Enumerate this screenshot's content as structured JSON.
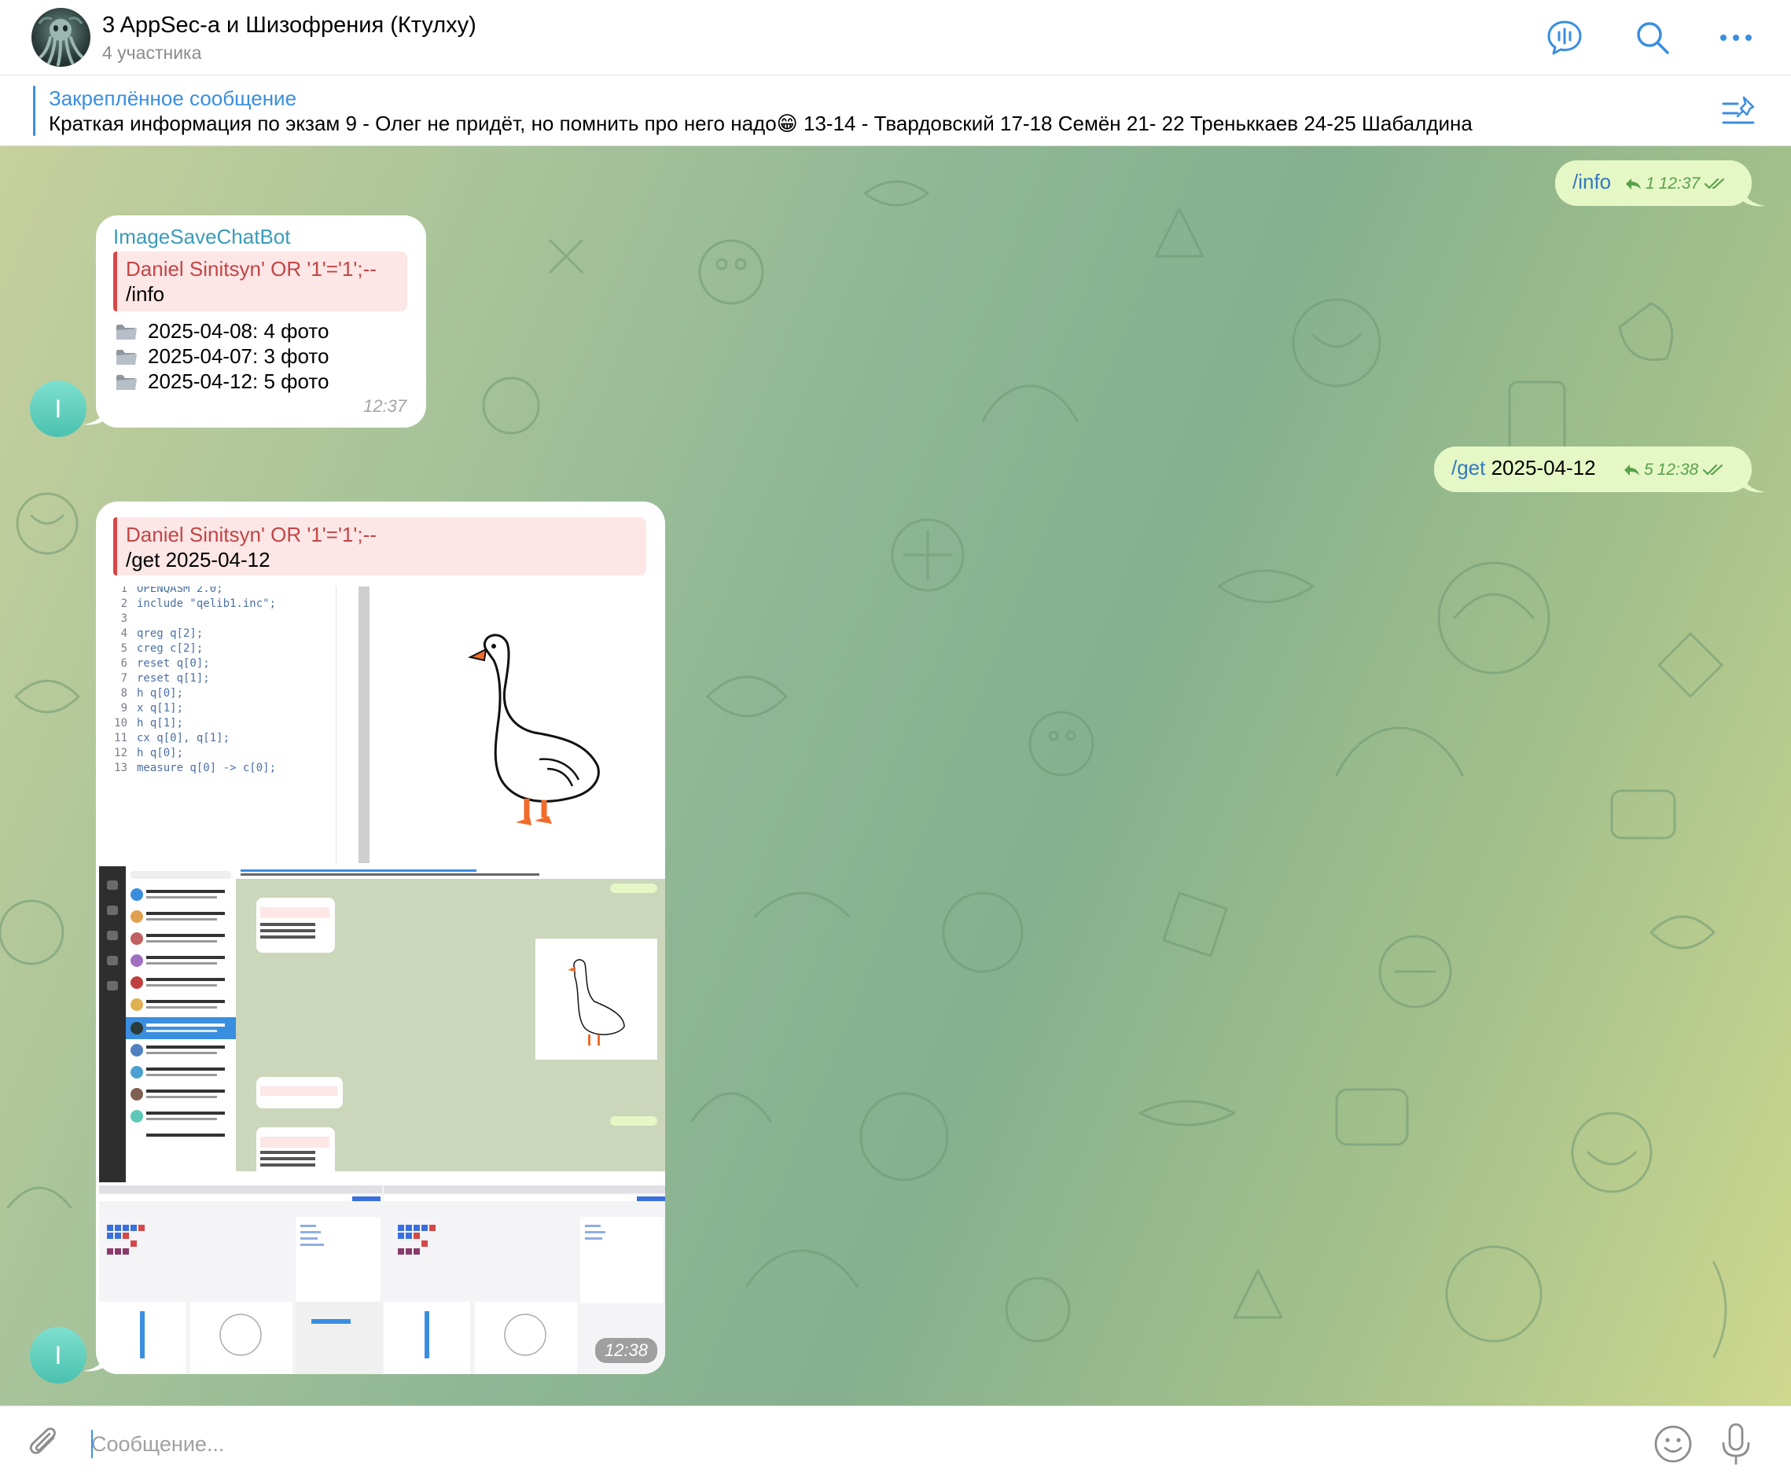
{
  "header": {
    "title": "3 AppSec-а и Шизофрения (Ктулху)",
    "subtitle": "4 участника"
  },
  "pinned": {
    "title": "Закреплённое сообщение",
    "text": "Краткая информация по экзам 9 - Олег не придёт, но помнить про него надо😁 13-14 - Твардовский 17-18 Семён 21- 22 Треньккаев 24-25 Шабалдина"
  },
  "messages": {
    "out_info": {
      "command": "/info",
      "replies": "1",
      "time": "12:37"
    },
    "bot_info": {
      "sender": "ImageSaveChatBot",
      "reply_name": "Daniel Sinitsyn' OR '1'='1';--",
      "reply_text": "/info",
      "lines": [
        "2025-04-08: 4 фото",
        "2025-04-07: 3 фото",
        "2025-04-12: 5 фото"
      ],
      "time": "12:37",
      "avatar_letter": "I"
    },
    "out_get": {
      "command": "/get",
      "arg": " 2025-04-12",
      "replies": "5",
      "time": "12:38"
    },
    "bot_album": {
      "reply_name": "Daniel Sinitsyn' OR '1'='1';--",
      "reply_text": "/get 2025-04-12",
      "time": "12:38",
      "avatar_letter": "I",
      "code": [
        {
          "n": "1",
          "t": "OPENQASM 2.0;"
        },
        {
          "n": "2",
          "t": "include \"qelib1.inc\";"
        },
        {
          "n": "3",
          "t": ""
        },
        {
          "n": "4",
          "t": "qreg q[2];"
        },
        {
          "n": "5",
          "t": "creg c[2];"
        },
        {
          "n": "6",
          "t": "reset q[0];"
        },
        {
          "n": "7",
          "t": "reset q[1];"
        },
        {
          "n": "8",
          "t": "h q[0];"
        },
        {
          "n": "9",
          "t": "x q[1];"
        },
        {
          "n": "10",
          "t": "h q[1];"
        },
        {
          "n": "11",
          "t": "cx q[0], q[1];"
        },
        {
          "n": "12",
          "t": "h q[0];"
        },
        {
          "n": "13",
          "t": "measure q[0] -> c[0];"
        }
      ]
    }
  },
  "composer": {
    "placeholder": "Сообщение..."
  },
  "colors": {
    "accent": "#3a8ee0",
    "outgoing_bubble": "#e6f7c6",
    "sender_name": "#3a9bb8",
    "reply_name": "#c24545",
    "read_check": "#58a14a"
  },
  "icons": {
    "header": [
      "voice-chat-icon",
      "search-icon",
      "more-icon"
    ],
    "pinned": "pinned-list-icon",
    "composer": [
      "attach-icon",
      "emoji-icon",
      "microphone-icon"
    ],
    "folder": "folder-icon"
  }
}
